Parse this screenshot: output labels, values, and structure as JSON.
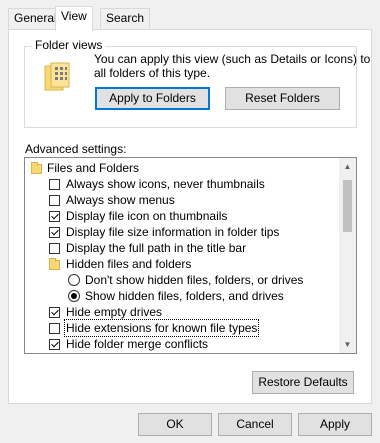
{
  "tabs": [
    "General",
    "View",
    "Search"
  ],
  "folder_views": {
    "title": "Folder views",
    "description_line1": "You can apply this view (such as Details or Icons) to",
    "description_line2": "all folders of this type.",
    "apply_button": "Apply to Folders",
    "reset_button": "Reset Folders"
  },
  "advanced": {
    "label": "Advanced settings:",
    "items": [
      {
        "type": "folder",
        "label": "Files and Folders"
      },
      {
        "type": "checkbox",
        "checked": false,
        "label": "Always show icons, never thumbnails"
      },
      {
        "type": "checkbox",
        "checked": false,
        "label": "Always show menus"
      },
      {
        "type": "checkbox",
        "checked": true,
        "label": "Display file icon on thumbnails"
      },
      {
        "type": "checkbox",
        "checked": true,
        "label": "Display file size information in folder tips"
      },
      {
        "type": "checkbox",
        "checked": false,
        "label": "Display the full path in the title bar"
      },
      {
        "type": "folder",
        "label": "Hidden files and folders"
      },
      {
        "type": "radio",
        "selected": false,
        "label": "Don't show hidden files, folders, or drives"
      },
      {
        "type": "radio",
        "selected": true,
        "label": "Show hidden files, folders, and drives"
      },
      {
        "type": "checkbox",
        "checked": true,
        "label": "Hide empty drives"
      },
      {
        "type": "checkbox",
        "checked": false,
        "label": "Hide extensions for known file types"
      },
      {
        "type": "checkbox",
        "checked": true,
        "label": "Hide folder merge conflicts"
      }
    ]
  },
  "restore_button": "Restore Defaults",
  "dialog_buttons": {
    "ok": "OK",
    "cancel": "Cancel",
    "apply": "Apply"
  },
  "colors": {
    "accent": "#0078d7",
    "folder": "#f8d775"
  }
}
